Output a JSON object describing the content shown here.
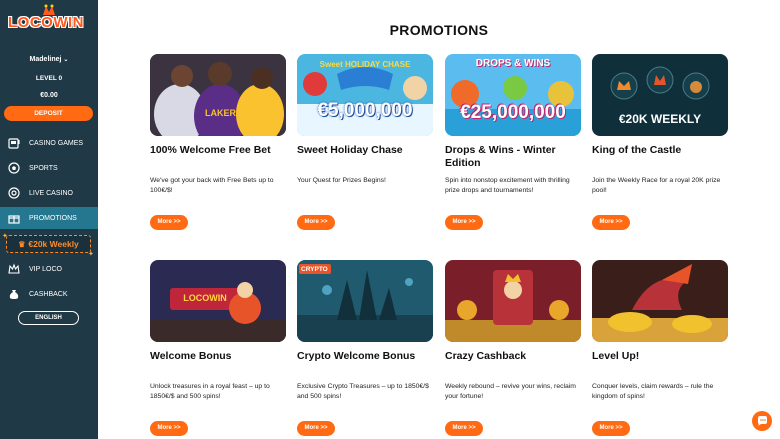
{
  "logo": {
    "part1": "LOCO",
    "part2": "WIN"
  },
  "user": {
    "name": "Madelinej",
    "level": "LEVEL 0",
    "balance": "€0.00",
    "deposit_label": "DEPOSIT"
  },
  "nav": [
    {
      "label": "CASINO GAMES",
      "icon": "slot-machine-icon"
    },
    {
      "label": "SPORTS",
      "icon": "soccer-ball-icon"
    },
    {
      "label": "LIVE CASINO",
      "icon": "chip-icon"
    },
    {
      "label": "PROMOTIONS",
      "icon": "gift-icon"
    },
    {
      "label": "VIP LOCO",
      "icon": "vip-crown-icon"
    },
    {
      "label": "CASHBACK",
      "icon": "money-bag-icon"
    }
  ],
  "weekly_button": {
    "label": "€20k Weekly"
  },
  "language": {
    "label": "ENGLISH"
  },
  "page_title": "PROMOTIONS",
  "more_label": "More >>",
  "promotions": [
    {
      "title": "100% Welcome Free Bet",
      "desc": "We've got your back with Free Bets up to 100€/$!",
      "banner_text": ""
    },
    {
      "title": "Sweet Holiday Chase",
      "desc": "Your Quest for Prizes Begins!",
      "banner_text": "€5,000,000",
      "banner_title": "Sweet HOLIDAY CHASE"
    },
    {
      "title": "Drops & Wins - Winter Edition",
      "desc": "Spin into nonstop excitement with thrilling prize drops and tournaments!",
      "banner_text": "€25,000,000",
      "banner_title": "DROPS & WINS"
    },
    {
      "title": "King of the Castle",
      "desc": "Join the Weekly Race for a royal 20K prize pool!",
      "banner_text": "€20K WEEKLY"
    },
    {
      "title": "Welcome Bonus",
      "desc": "Unlock treasures in a royal feast – up to 1850€/$ and 500 spins!",
      "banner_title": "LOCOWIN"
    },
    {
      "title": "Crypto Welcome Bonus",
      "desc": "Exclusive Crypto Treasures – up to 1850€/$ and 500 spins!",
      "banner_title": "CRYPTO"
    },
    {
      "title": "Crazy Cashback",
      "desc": "Weekly rebound – revive your wins, reclaim your fortune!"
    },
    {
      "title": "Level Up!",
      "desc": "Conquer levels, claim rewards – rule the kingdom of spins!"
    }
  ],
  "colors": {
    "sidebar": "#1f3a46",
    "accent": "#ff6a13",
    "active_nav": "#24778f"
  }
}
